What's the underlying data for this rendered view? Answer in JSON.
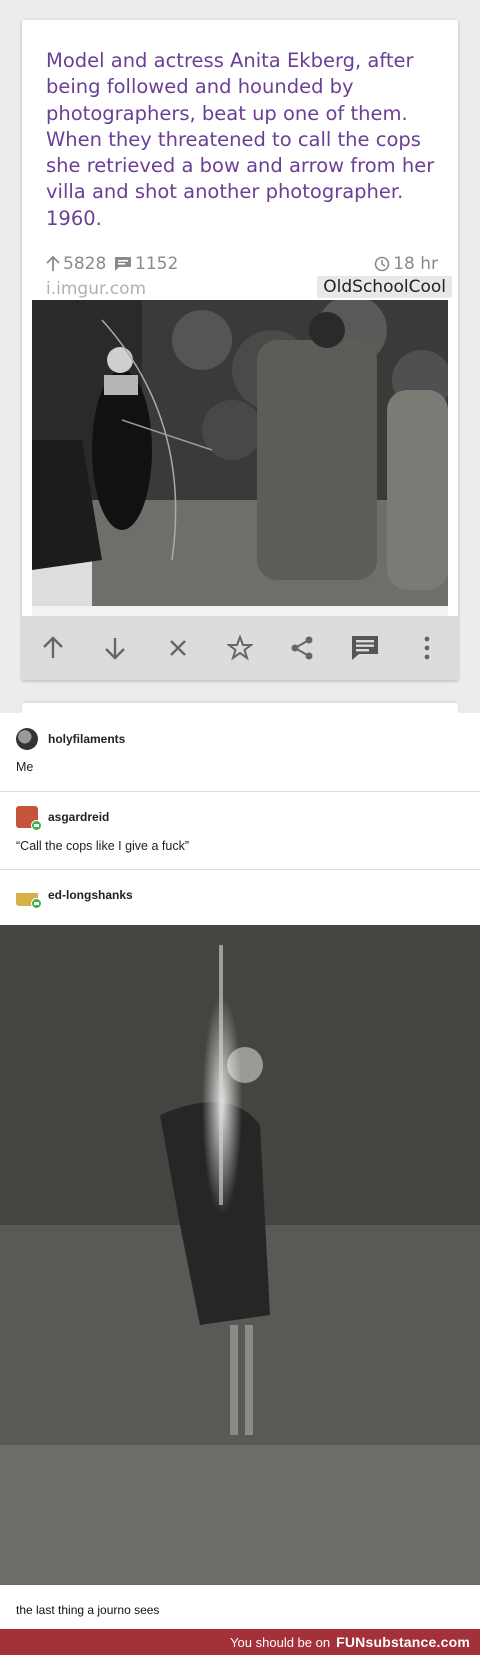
{
  "post": {
    "title": "Model and actress Anita Ekberg, after being followed and hounded by photographers, beat up one of them. When they threatened to call the cops she retrieved a bow and arrow from her villa and shot another photographer. 1960.",
    "score": "5828",
    "comments": "1152",
    "age": "18 hr",
    "domain": "i.imgur.com",
    "subreddit": "OldSchoolCool"
  },
  "actions": [
    "upvote-icon",
    "downvote-icon",
    "hide-icon",
    "save-star-icon",
    "share-icon",
    "comments-icon",
    "more-icon"
  ],
  "thread": [
    {
      "user": "holyfilaments",
      "text": "Me"
    },
    {
      "user": "asgardreid",
      "text": "“Call the cops like I give a fuck”"
    },
    {
      "user": "ed-longshanks",
      "caption": "the last thing a journo sees"
    }
  ],
  "footer": {
    "message": "You should be on",
    "brand": "FUNsubstance.com"
  },
  "colors": {
    "title": "#6a3f96",
    "footer": "#a4303a",
    "action_bar": "#dcdcdc"
  }
}
